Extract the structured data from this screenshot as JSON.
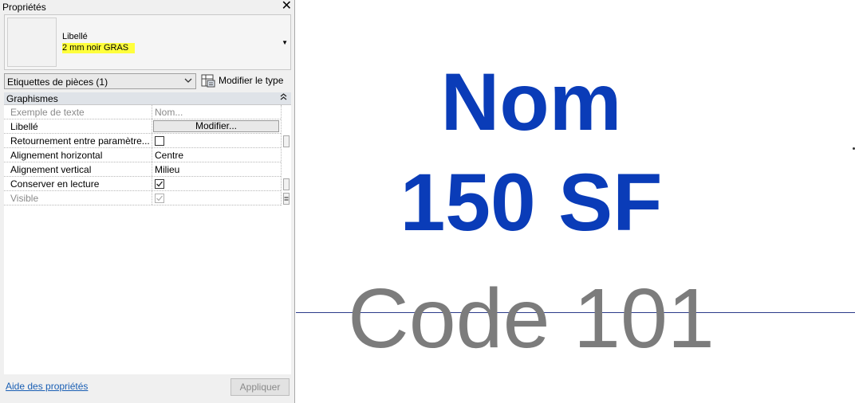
{
  "palette": {
    "title": "Propriétés",
    "type_selector": {
      "family": "Libellé",
      "type": "2 mm noir GRAS"
    },
    "filter": {
      "selected": "Etiquettes de pièces (1)"
    },
    "edit_type_label": "Modifier le type",
    "group": {
      "name": "Graphismes"
    },
    "rows": [
      {
        "name": "Exemple de texte",
        "value": "Nom..."
      },
      {
        "name": "Libellé",
        "button": "Modifier..."
      },
      {
        "name": "Retournement entre paramètre...",
        "checked": false
      },
      {
        "name": "Alignement horizontal",
        "value": "Centre"
      },
      {
        "name": "Alignement vertical",
        "value": "Milieu"
      },
      {
        "name": "Conserver en lecture",
        "checked": true
      },
      {
        "name": "Visible",
        "checked": true
      }
    ],
    "help_link": "Aide des propriétés",
    "apply_label": "Appliquer"
  },
  "canvas": {
    "tag_lines": [
      "Nom",
      "150 SF",
      "Code 101"
    ],
    "colors": {
      "primary": "#0a3cb8",
      "secondary": "#7c7c7c",
      "highlight": "#ffff3c"
    }
  }
}
